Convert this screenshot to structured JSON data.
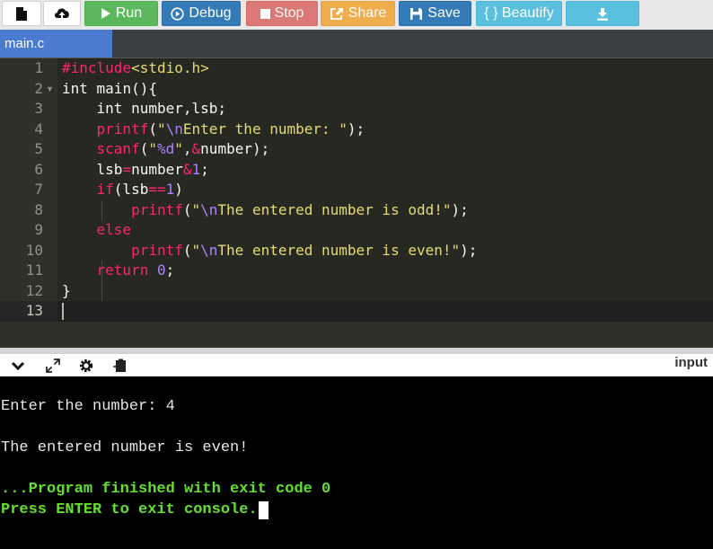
{
  "toolbar": {
    "run_label": "Run",
    "debug_label": "Debug",
    "stop_label": "Stop",
    "share_label": "Share",
    "save_label": "Save",
    "beautify_label": "{ } Beautify",
    "icons": [
      "file-icon",
      "upload-icon",
      "play-icon",
      "debug-icon",
      "stop-icon",
      "share-icon",
      "save-icon",
      "download-icon"
    ]
  },
  "tabs": [
    {
      "label": "main.c",
      "active": true
    }
  ],
  "editor": {
    "line_numbers": [
      "1",
      "2",
      "3",
      "4",
      "5",
      "6",
      "7",
      "8",
      "9",
      "10",
      "11",
      "12",
      "13"
    ],
    "lines": [
      "#include<stdio.h>",
      "int main(){",
      "    int number,lsb;",
      "    printf(\"\\nEnter the number: \");",
      "    scanf(\"%d\",&number);",
      "    lsb=number&1;",
      "    if(lsb==1)",
      "        printf(\"\\nThe entered number is odd!\");",
      "    else",
      "        printf(\"\\nThe entered number is even!\");",
      "    return 0;",
      "}",
      ""
    ],
    "active_line": 13
  },
  "console": {
    "input_label": "input",
    "lines": [
      {
        "text": "Enter the number: 4",
        "style": "white"
      },
      {
        "text": "",
        "style": "white"
      },
      {
        "text": "The entered number is even!",
        "style": "white"
      },
      {
        "text": "",
        "style": "white"
      },
      {
        "text": "...Program finished with exit code 0",
        "style": "green"
      },
      {
        "text": "Press ENTER to exit console.",
        "style": "green"
      }
    ]
  },
  "colors": {
    "run": "#5cb85c",
    "debug": "#337ab7",
    "stop": "#d9534f",
    "share": "#f0ad4e",
    "save": "#337ab7",
    "beautify": "#5bc0de",
    "tab_active": "#4a7bd0",
    "editor_bg": "#272822",
    "console_bg": "#000000",
    "console_green": "#62e02c"
  }
}
